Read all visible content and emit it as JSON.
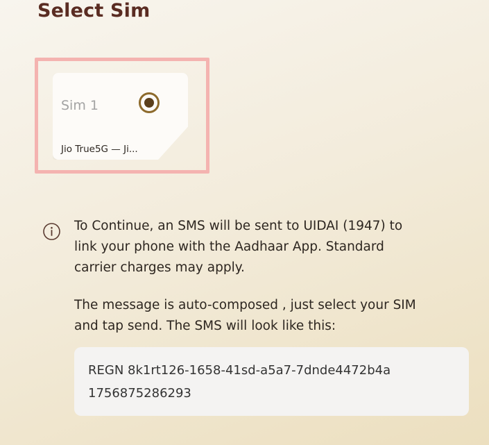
{
  "header": {
    "title": "Select Sim"
  },
  "sim_card": {
    "name": "Sim 1",
    "carrier": "Jio True5G — Ji...",
    "selected": true,
    "radio_icon": "radio-selected-icon"
  },
  "info": {
    "icon": "info-icon",
    "paragraph1_lines": [
      "To Continue, an SMS will be sent to UIDAI (1947) to",
      "link your phone with the Aadhaar App. Standard",
      "carrier charges may apply."
    ],
    "paragraph2_lines": [
      "The message is auto-composed , just select your SIM",
      "and tap send. The SMS will look like this:"
    ]
  },
  "sms_preview": {
    "line1": "REGN 8k1rt126-1658-41sd-a5a7-7dnde4472b4a",
    "line2": "1756875286293"
  },
  "colors": {
    "title": "#5a2c22",
    "highlight_border": "#f4b3b0",
    "radio_accent": "#8d6a2c"
  }
}
